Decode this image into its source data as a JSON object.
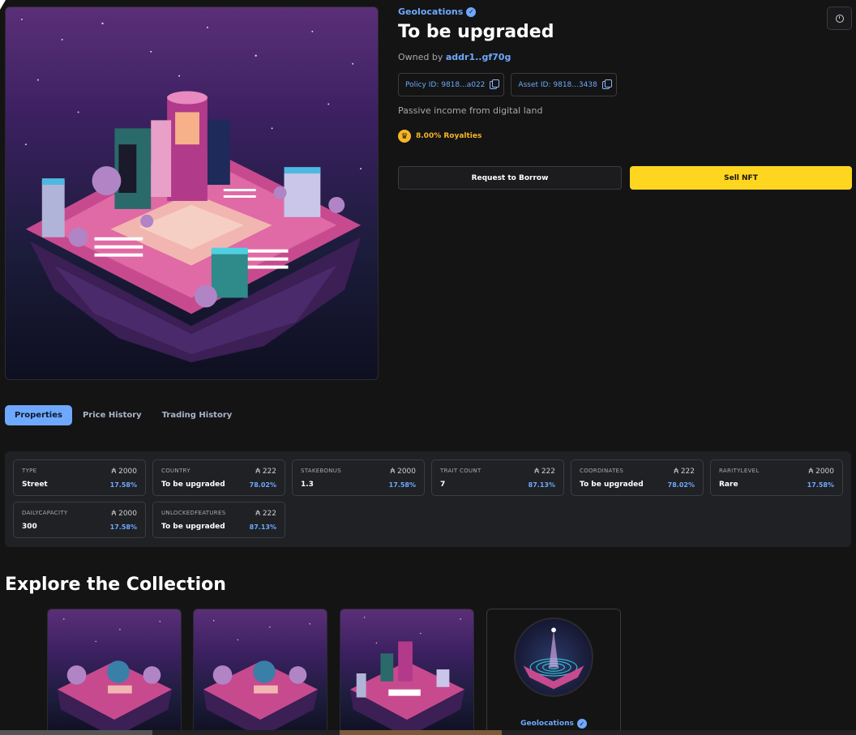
{
  "nft": {
    "collection": "Geolocations",
    "title": "To be upgraded",
    "owned_by_label": "Owned by",
    "owner_address": "addr1..gf70g",
    "policy_id": "Policy ID: 9818...a022",
    "asset_id": "Asset ID: 9818...3438",
    "description": "Passive income from digital land",
    "royalties": "8.00% Royalties"
  },
  "actions": {
    "borrow_label": "Request to Borrow",
    "sell_label": "Sell NFT"
  },
  "tabs": [
    {
      "label": "Properties",
      "active": true
    },
    {
      "label": "Price History",
      "active": false
    },
    {
      "label": "Trading History",
      "active": false
    }
  ],
  "properties": [
    {
      "label": "TYPE",
      "count": "₳ 2000",
      "value": "Street",
      "pct": "17.58%"
    },
    {
      "label": "COUNTRY",
      "count": "₳ 222",
      "value": "To be upgraded",
      "pct": "78.02%"
    },
    {
      "label": "STAKEBONUS",
      "count": "₳ 2000",
      "value": "1.3",
      "pct": "17.58%"
    },
    {
      "label": "TRAIT COUNT",
      "count": "₳ 222",
      "value": "7",
      "pct": "87.13%"
    },
    {
      "label": "COORDINATES",
      "count": "₳ 222",
      "value": "To be upgraded",
      "pct": "78.02%"
    },
    {
      "label": "RARITYLEVEL",
      "count": "₳ 2000",
      "value": "Rare",
      "pct": "17.58%"
    },
    {
      "label": "DAILYCAPACITY",
      "count": "₳ 2000",
      "value": "300",
      "pct": "17.58%"
    },
    {
      "label": "UNLOCKEDFEATURES",
      "count": "₳ 222",
      "value": "To be upgraded",
      "pct": "87.13%"
    }
  ],
  "explore": {
    "title": "Explore the Collection",
    "collection_card_name": "Geolocations"
  },
  "colors": {
    "accent": "#6ea8ff",
    "sell": "#ffd61f",
    "royalty": "#f5b62a"
  }
}
